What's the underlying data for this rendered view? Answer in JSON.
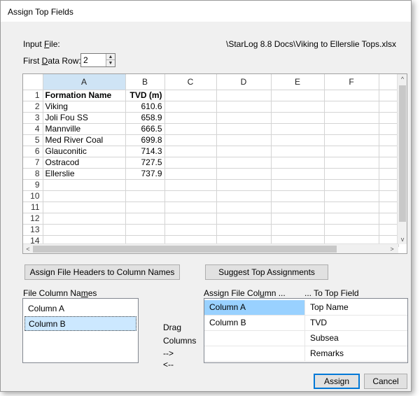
{
  "window": {
    "title": "Assign Top Fields"
  },
  "input_file": {
    "label": "Input File:",
    "path": "\\StarLog 8.8 Docs\\Viking to Ellerslie Tops.xlsx"
  },
  "first_data_row": {
    "label": "First Data Row:",
    "value": "2"
  },
  "grid": {
    "columns": [
      "A",
      "B",
      "C",
      "D",
      "E",
      "F"
    ],
    "rows": [
      {
        "n": "1",
        "a": "Formation Name",
        "b": "TVD (m)"
      },
      {
        "n": "2",
        "a": "Viking",
        "b": "610.6"
      },
      {
        "n": "3",
        "a": "Joli Fou SS",
        "b": "658.9"
      },
      {
        "n": "4",
        "a": "Mannville",
        "b": "666.5"
      },
      {
        "n": "5",
        "a": "Med River Coal",
        "b": "699.8"
      },
      {
        "n": "6",
        "a": "Glauconitic",
        "b": "714.3"
      },
      {
        "n": "7",
        "a": "Ostracod",
        "b": "727.5"
      },
      {
        "n": "8",
        "a": "Ellerslie",
        "b": "737.9"
      },
      {
        "n": "9",
        "a": "",
        "b": ""
      },
      {
        "n": "10",
        "a": "",
        "b": ""
      },
      {
        "n": "11",
        "a": "",
        "b": ""
      },
      {
        "n": "12",
        "a": "",
        "b": ""
      },
      {
        "n": "13",
        "a": "",
        "b": ""
      },
      {
        "n": "14",
        "a": "",
        "b": ""
      }
    ]
  },
  "buttons": {
    "assign_headers": "Assign File Headers to Column Names",
    "suggest": "Suggest Top Assignments",
    "assign": "Assign",
    "cancel": "Cancel"
  },
  "file_columns": {
    "label": "File Column Names",
    "items": [
      "Column A",
      "Column B"
    ],
    "selected_index": 1
  },
  "drag_hint": {
    "line1": "Drag",
    "line2": "Columns",
    "line3": "-->",
    "line4": "<--"
  },
  "assign_table": {
    "header_left": "Assign File Column ...",
    "header_right": "... To Top Field",
    "rows": [
      {
        "file_column": "Column A",
        "top_field": "Top Name",
        "selected": true
      },
      {
        "file_column": "Column B",
        "top_field": "TVD",
        "selected": false
      },
      {
        "file_column": "",
        "top_field": "Subsea",
        "selected": false
      },
      {
        "file_column": "",
        "top_field": "Remarks",
        "selected": false
      }
    ]
  },
  "colors": {
    "selection": "#99d1ff",
    "header_selected": "#cfe4f5",
    "default_button_border": "#0078d7"
  }
}
